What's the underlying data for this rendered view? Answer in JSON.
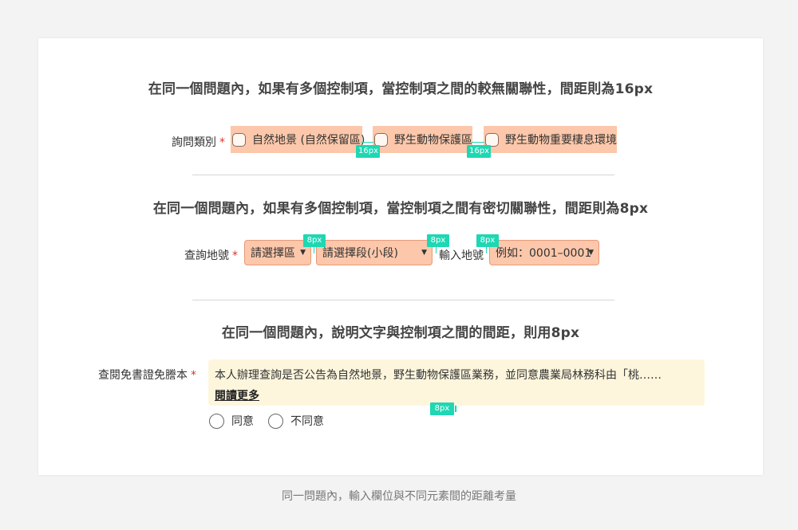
{
  "section1": {
    "title": "在同一個問題內，如果有多個控制項，當控制項之間的較無關聯性，間距則為16px",
    "label": "詢問類別",
    "required_mark": "*",
    "options": [
      "自然地景 (自然保留區)",
      "野生動物保護區",
      "野生動物重要棲息環境"
    ],
    "spacing_tags": [
      "16px",
      "16px"
    ]
  },
  "section2": {
    "title": "在同一個問題內，如果有多個控制項，當控制項之間有密切關聯性，間距則為8px",
    "label": "查詢地號",
    "required_mark": "*",
    "select_district": "請選擇區",
    "select_section": "請選擇段(小段)",
    "input_label": "輸入地號",
    "lot_placeholder": "例如：0001–0001",
    "spacing_tags": [
      "8px",
      "8px",
      "8px"
    ]
  },
  "section3": {
    "title": "在同一個問題內，說明文字與控制項之間的間距，則用8px",
    "label": "查閱免書證免謄本",
    "required_mark": "*",
    "notice_text": "本人辦理查詢是否公告為自然地景，野生動物保護區業務，並同意農業局林務科由「桃……",
    "read_more": "閱讀更多",
    "spacing_tag": "8px",
    "radio_agree": "同意",
    "radio_disagree": "不同意"
  },
  "caption": "同一問題內，輸入欄位與不同元素間的距離考量",
  "colors": {
    "highlight": "#fcc7aa",
    "spacing_tag": "#1ed7b3",
    "notice_bg": "#fdf6dd",
    "required": "#e0322c"
  }
}
